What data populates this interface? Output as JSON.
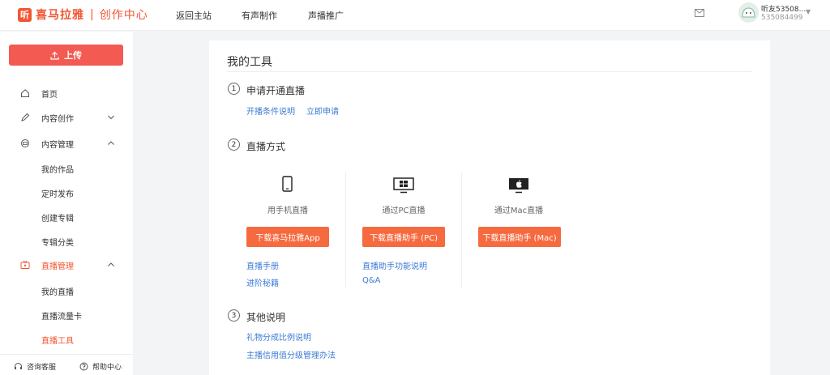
{
  "header": {
    "logo_glyph": "听",
    "logo_name": "喜马拉雅",
    "logo_sep": "|",
    "logo_sub": "创作中心",
    "nav": [
      "返回主站",
      "有声制作",
      "声播推广"
    ],
    "user_name": "听友53508...",
    "user_id": "535084499",
    "icons": {
      "mail": "mail-icon",
      "caret": "chevron-down-icon"
    }
  },
  "sidebar": {
    "upload_label": "上传",
    "items": [
      {
        "label": "首页",
        "icon": "home-icon"
      },
      {
        "label": "内容创作",
        "icon": "pen-icon",
        "expanded": false
      },
      {
        "label": "内容管理",
        "icon": "folder-icon",
        "expanded": true
      },
      {
        "label": "直播管理",
        "icon": "tv-icon",
        "expanded": true,
        "active": true
      }
    ],
    "content_sub": [
      "我的作品",
      "定时发布",
      "创建专辑",
      "专辑分类"
    ],
    "live_sub": [
      "我的直播",
      "直播流量卡",
      "直播工具"
    ],
    "active_sub": "直播工具",
    "footer": [
      "咨询客服",
      "帮助中心"
    ]
  },
  "main": {
    "title": "我的工具",
    "sections": [
      {
        "num": "1",
        "title": "申请开通直播",
        "links": [
          "开播条件说明",
          "立即申请"
        ]
      },
      {
        "num": "2",
        "title": "直播方式"
      },
      {
        "num": "3",
        "title": "其他说明",
        "links": [
          "礼物分成比例说明",
          "主播信用值分级管理办法"
        ]
      }
    ],
    "methods": [
      {
        "label": "用手机直播",
        "button": "下载喜马拉雅App",
        "links": [
          "直播手册",
          "进阶秘籍"
        ],
        "icon": "phone-icon"
      },
      {
        "label": "通过PC直播",
        "button": "下载直播助手 (PC)",
        "links": [
          "直播助手功能说明",
          "Q&A"
        ],
        "icon": "windows-monitor-icon"
      },
      {
        "label": "通过Mac直播",
        "button": "下载直播助手 (Mac)",
        "links": [],
        "icon": "apple-monitor-icon"
      }
    ]
  },
  "colors": {
    "brand": "#f25533",
    "upload": "#f25a52",
    "button": "#f66a3f",
    "link": "#3d7bd4"
  }
}
